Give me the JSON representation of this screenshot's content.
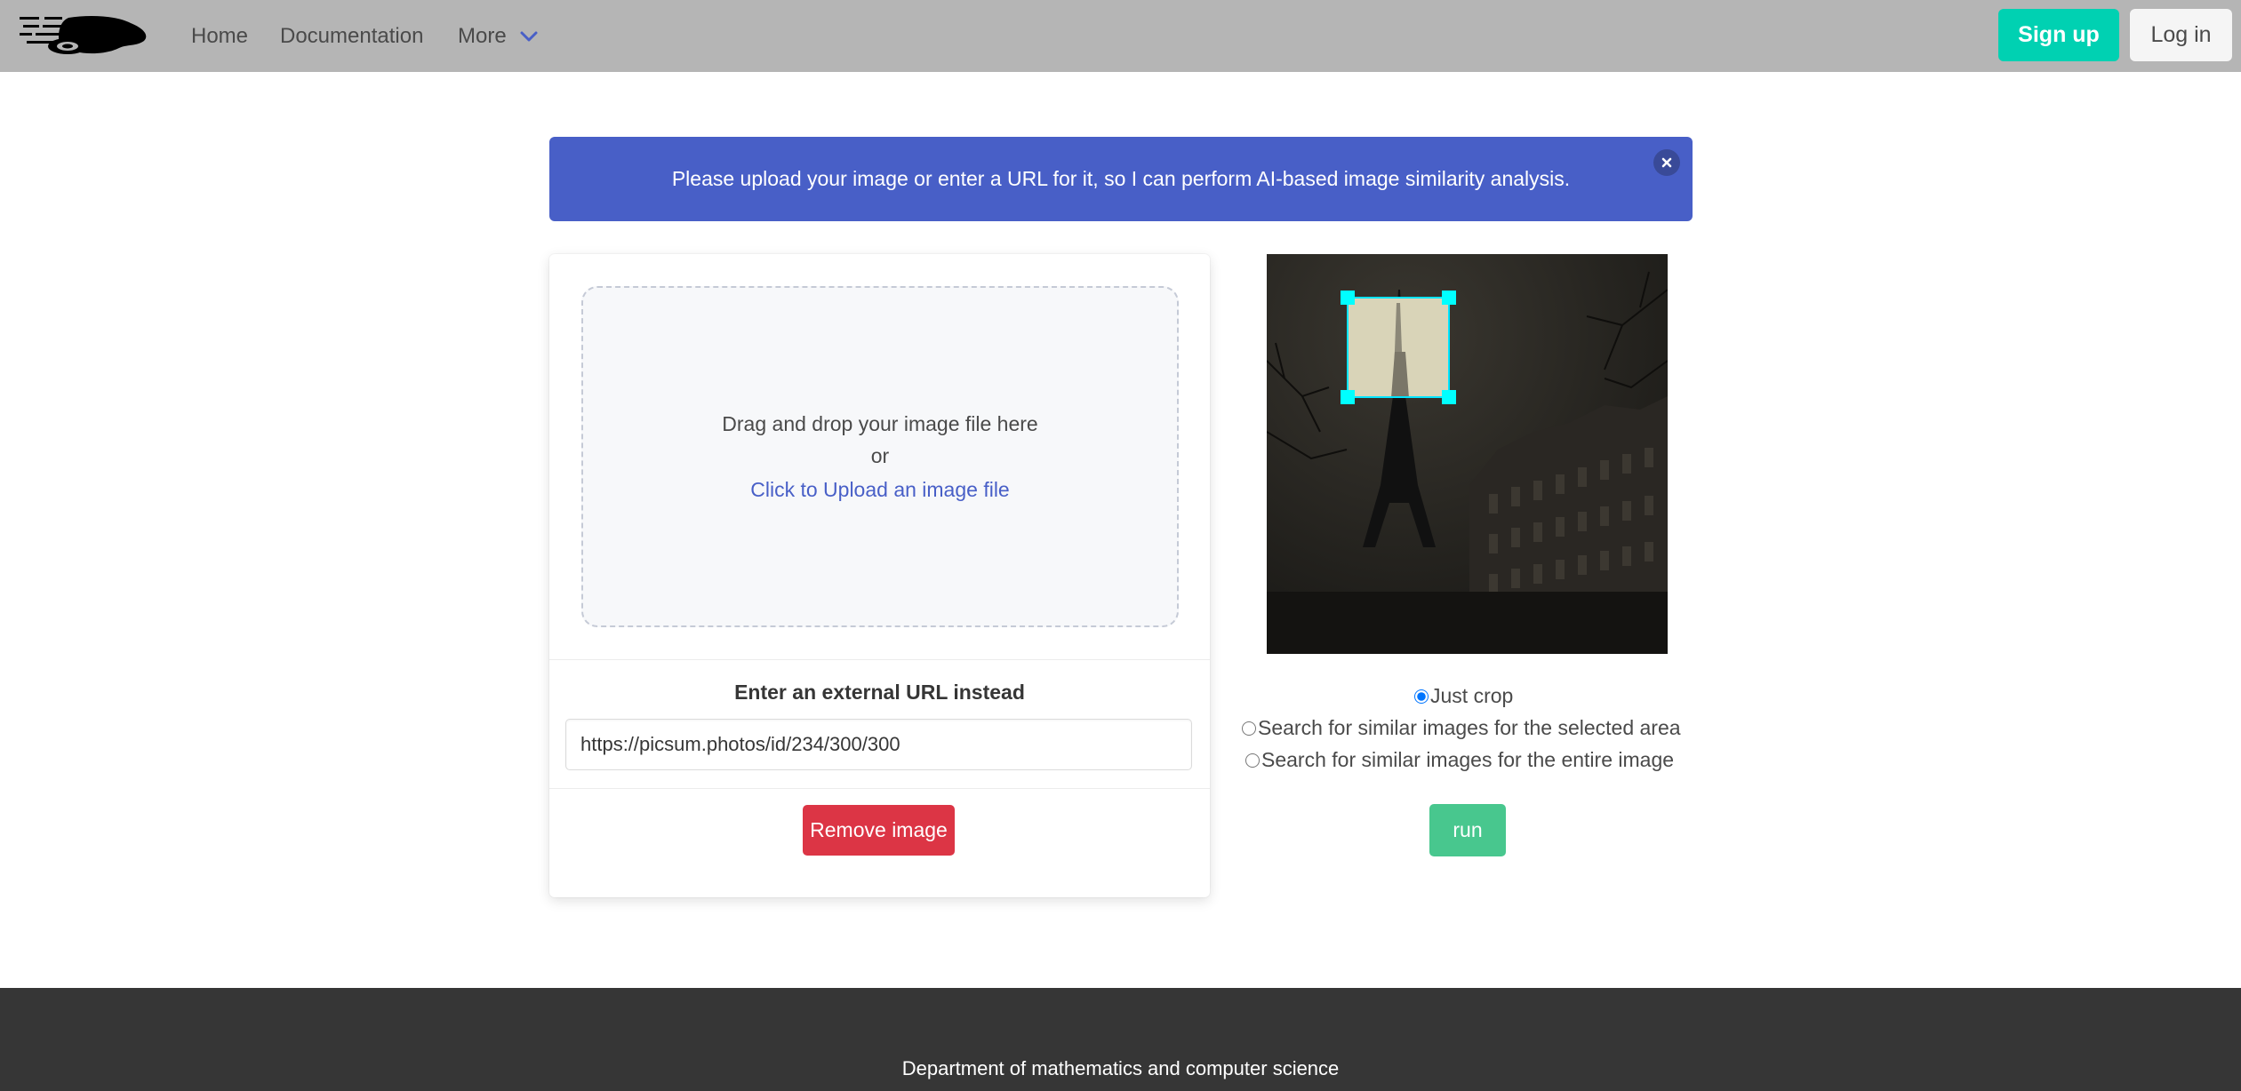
{
  "navbar": {
    "logo_icon": "brain-circuit-logo",
    "items": [
      {
        "label": "Home"
      },
      {
        "label": "Documentation"
      },
      {
        "label": "More"
      }
    ],
    "more_icon": "chevron-down-icon",
    "signup_label": "Sign up",
    "login_label": "Log in",
    "colors": {
      "background": "#b5b5b5",
      "signup": "#00d1b2",
      "login": "#f5f5f5"
    }
  },
  "notification": {
    "text": "Please upload your image or enter a URL for it, so I can perform AI-based image similarity analysis.",
    "close_icon": "close-icon",
    "color": "#485fc7"
  },
  "upload": {
    "drop_text": "Drag and drop your image file here",
    "or_text": "or",
    "upload_link": "Click to Upload an image file",
    "url_label": "Enter an external URL instead",
    "url_value": "https://picsum.photos/id/234/300/300",
    "remove_label": "Remove image",
    "remove_color": "#dc3545"
  },
  "preview": {
    "description_icon": "image-preview",
    "crop_color": "#00ffff"
  },
  "options": {
    "items": [
      {
        "label": "Just crop",
        "checked": true
      },
      {
        "label": "Search for similar images for the selected area",
        "checked": false
      },
      {
        "label": "Search for similar images for the entire image",
        "checked": false
      }
    ],
    "run_label": "run",
    "run_color": "#48c78e"
  },
  "footer": {
    "text": "Department of mathematics and computer science"
  }
}
